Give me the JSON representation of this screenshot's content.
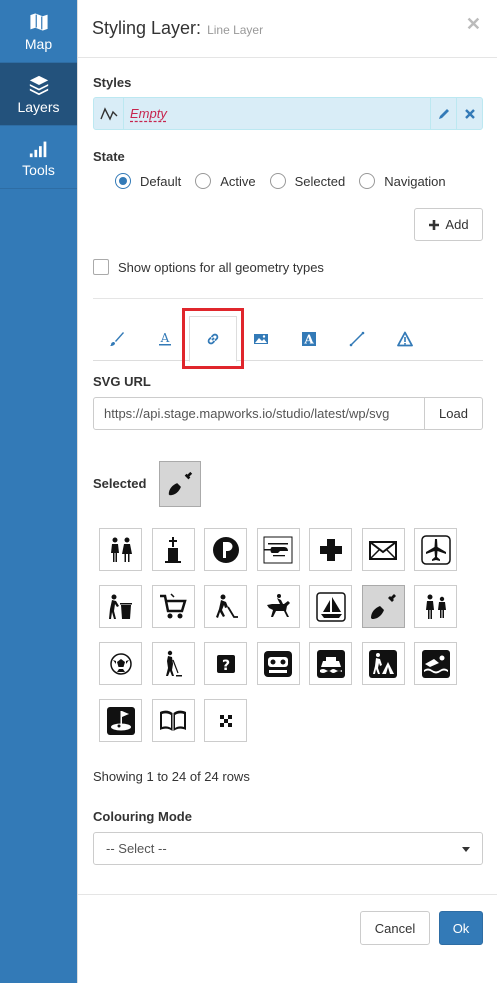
{
  "sidebar": {
    "items": [
      {
        "label": "Map",
        "icon": "map-icon"
      },
      {
        "label": "Layers",
        "icon": "layers-icon"
      },
      {
        "label": "Tools",
        "icon": "signal-icon"
      }
    ]
  },
  "header": {
    "title": "Styling Layer:",
    "subtitle": "Line Layer",
    "close": "✕"
  },
  "styles": {
    "label": "Styles",
    "item_name": "Empty"
  },
  "state": {
    "label": "State",
    "options": [
      "Default",
      "Active",
      "Selected",
      "Navigation"
    ],
    "selected": "Default"
  },
  "add_button": {
    "label": "Add",
    "icon": "plus-icon"
  },
  "show_all_geom": {
    "label": "Show options for all geometry types",
    "checked": false
  },
  "tabs": [
    {
      "icon": "brush-icon"
    },
    {
      "icon": "text-underline-icon"
    },
    {
      "icon": "link-icon",
      "active": true
    },
    {
      "icon": "image-icon"
    },
    {
      "icon": "font-box-icon"
    },
    {
      "icon": "line-icon"
    },
    {
      "icon": "warning-icon"
    }
  ],
  "svg_url": {
    "label": "SVG URL",
    "value": "https://api.stage.mapworks.io/studio/latest/wp/svg",
    "load_label": "Load"
  },
  "selected": {
    "label": "Selected",
    "icon": "shovel-icon"
  },
  "icons": [
    "restroom-icon",
    "cemetery-icon",
    "parking-icon",
    "helicopter-icon",
    "first-aid-icon",
    "mail-icon",
    "airport-icon",
    "litter-icon",
    "shopping-cart-icon",
    "hockey-icon",
    "horse-riding-icon",
    "sailing-icon",
    "shovel-icon",
    "family-icon",
    "soccer-icon",
    "golfer-icon",
    "information-icon",
    "theater-icon",
    "ferry-icon",
    "hiking-camp-icon",
    "swimming-icon",
    "golf-course-icon",
    "book-icon",
    "checkered-icon"
  ],
  "selected_icon_index": 12,
  "pagination": {
    "text": "Showing 1 to 24 of 24 rows"
  },
  "colouring_mode": {
    "label": "Colouring Mode",
    "value": "-- Select --"
  },
  "footer": {
    "cancel_label": "Cancel",
    "ok_label": "Ok"
  },
  "colors": {
    "sidebar": "#337ab7",
    "sidebar_active": "#23527c",
    "primary": "#337ab7",
    "highlight": "#e0262c",
    "style_row": "#d9edf7"
  }
}
